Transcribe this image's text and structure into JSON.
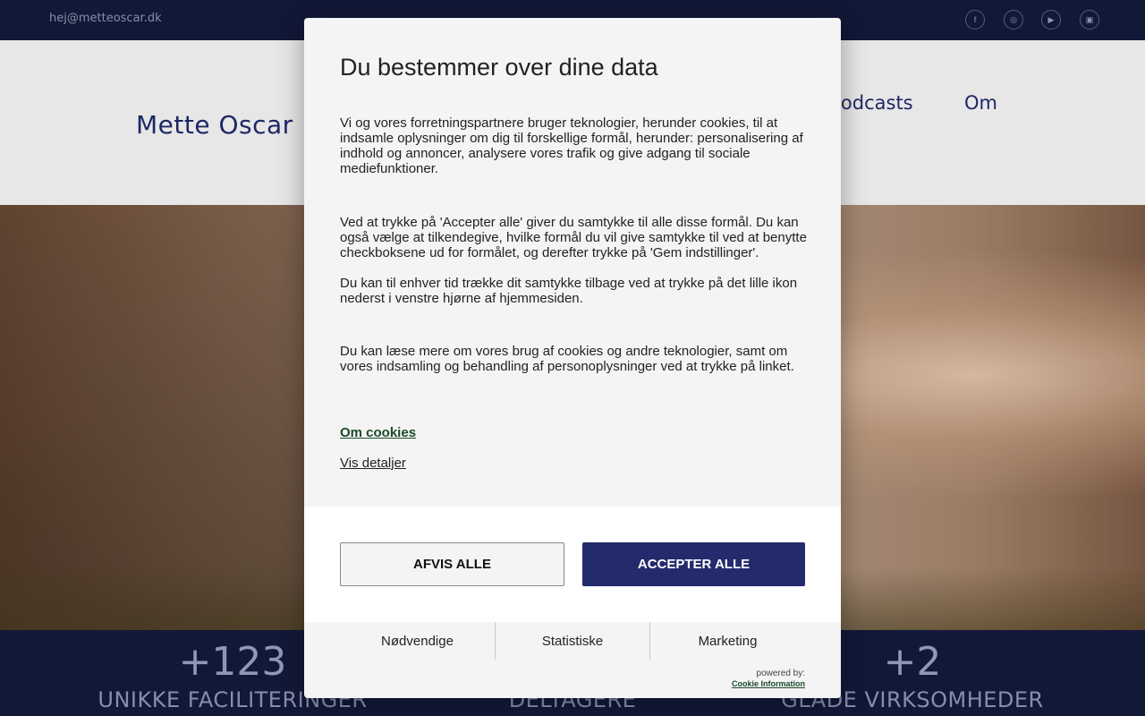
{
  "topbar": {
    "email": "hej@metteoscar.dk",
    "social": [
      {
        "icon": "facebook-icon",
        "glyph": "f"
      },
      {
        "icon": "instagram-icon",
        "glyph": "◎"
      },
      {
        "icon": "youtube-icon",
        "glyph": "▶"
      },
      {
        "icon": "linkedin-icon",
        "glyph": "▣"
      }
    ]
  },
  "header": {
    "logo": "Mette Oscar",
    "nav": [
      "Podcasts",
      "Om"
    ]
  },
  "stats": [
    {
      "number": "+123",
      "label": "UNIKKE FACILITERINGER"
    },
    {
      "number": "",
      "label": "DELTAGERE"
    },
    {
      "number": "+2",
      "label": "GLADE VIRKSOMHEDER"
    }
  ],
  "consent": {
    "title": "Du bestemmer over dine data",
    "p1": "Vi og vores forretningspartnere bruger teknologier, herunder cookies, til at indsamle oplysninger om dig til forskellige formål, herunder: personalisering af indhold og annoncer, analysere vores trafik og give adgang til sociale mediefunktioner.",
    "p2": "Ved at trykke på 'Accepter alle' giver du samtykke til alle disse formål. Du kan også vælge at tilkendegive, hvilke formål du vil give samtykke til ved at benytte checkboksene ud for formålet, og derefter trykke på 'Gem indstillinger'.",
    "p3": "Du kan til enhver tid trække dit samtykke tilbage ved at trykke på det lille ikon nederst i venstre hjørne af hjemmesiden.",
    "p4": "Du kan læse mere om vores brug af cookies og andre teknologier, samt om vores indsamling og behandling af personoplysninger ved at trykke på linket.",
    "link_cookies": "Om cookies",
    "link_details": "Vis detaljer",
    "reject_label": "AFVIS ALLE",
    "accept_label": "ACCEPTER ALLE",
    "tabs": [
      "Nødvendige",
      "Statistiske",
      "Marketing"
    ],
    "powered_by": "powered by:",
    "provider": "Cookie Information",
    "accent_color": "#232b6d"
  }
}
